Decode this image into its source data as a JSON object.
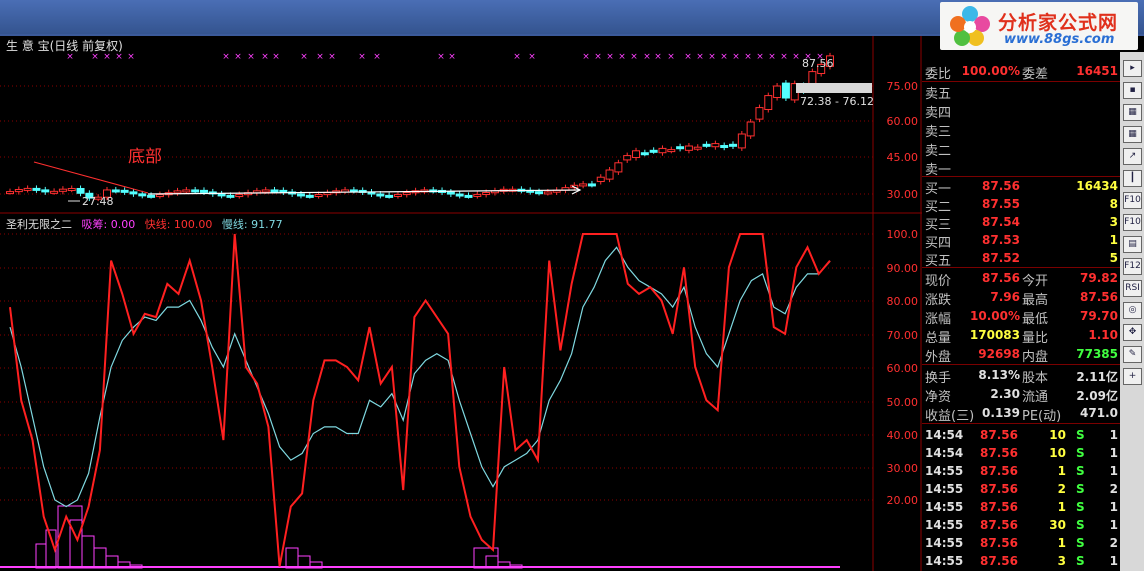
{
  "header": {
    "title": "生 意 宝(日线 前复权)",
    "logo_text": "分析家公式网",
    "logo_url": "www.88gs.com"
  },
  "main_chart": {
    "annotation": "底部",
    "low_label": "27.48",
    "high_label": "87.56",
    "range_label": "72.38 - 76.12",
    "y_ticks": [
      "75.00",
      "60.00",
      "45.00",
      "30.00"
    ]
  },
  "indicator": {
    "name": "圣利无限之二",
    "xichou_label": "吸筹: 0.00",
    "fast_label": "快线: 100.00",
    "slow_label": "慢线: 91.77",
    "y_ticks": [
      "100.0",
      "90.00",
      "80.00",
      "70.00",
      "60.00",
      "50.00",
      "40.00",
      "30.00",
      "20.00"
    ]
  },
  "quote": {
    "weibi": {
      "label": "委比",
      "value": "100.00%",
      "label2": "委差",
      "value2": "16451"
    },
    "sell": [
      {
        "label": "卖五",
        "price": "",
        "vol": ""
      },
      {
        "label": "卖四",
        "price": "",
        "vol": ""
      },
      {
        "label": "卖三",
        "price": "",
        "vol": ""
      },
      {
        "label": "卖二",
        "price": "",
        "vol": ""
      },
      {
        "label": "卖一",
        "price": "",
        "vol": ""
      }
    ],
    "buy": [
      {
        "label": "买一",
        "price": "87.56",
        "vol": "16434"
      },
      {
        "label": "买二",
        "price": "87.55",
        "vol": "8"
      },
      {
        "label": "买三",
        "price": "87.54",
        "vol": "3"
      },
      {
        "label": "买四",
        "price": "87.53",
        "vol": "1"
      },
      {
        "label": "买五",
        "price": "87.52",
        "vol": "5"
      }
    ],
    "stats": [
      {
        "l1": "现价",
        "v1": "87.56",
        "l2": "今开",
        "v2": "79.82"
      },
      {
        "l1": "涨跌",
        "v1": "7.96",
        "l2": "最高",
        "v2": "87.56"
      },
      {
        "l1": "涨幅",
        "v1": "10.00%",
        "l2": "最低",
        "v2": "79.70"
      },
      {
        "l1": "总量",
        "v1": "170083",
        "l2": "量比",
        "v2": "1.10"
      },
      {
        "l1": "外盘",
        "v1": "92698",
        "l2": "内盘",
        "v2": "77385"
      }
    ],
    "stats2": [
      {
        "l1": "换手",
        "v1": "8.13%",
        "l2": "股本",
        "v2": "2.11亿"
      },
      {
        "l1": "净资",
        "v1": "2.30",
        "l2": "流通",
        "v2": "2.09亿"
      },
      {
        "l1": "收益(三)",
        "v1": "0.139",
        "l2": "PE(动)",
        "v2": "471.0"
      }
    ],
    "ticks": [
      {
        "time": "14:54",
        "price": "87.56",
        "vol": "10",
        "side": "S",
        "n": "1"
      },
      {
        "time": "14:54",
        "price": "87.56",
        "vol": "10",
        "side": "S",
        "n": "1"
      },
      {
        "time": "14:55",
        "price": "87.56",
        "vol": "1",
        "side": "S",
        "n": "1"
      },
      {
        "time": "14:55",
        "price": "87.56",
        "vol": "2",
        "side": "S",
        "n": "2"
      },
      {
        "time": "14:55",
        "price": "87.56",
        "vol": "1",
        "side": "S",
        "n": "1"
      },
      {
        "time": "14:55",
        "price": "87.56",
        "vol": "30",
        "side": "S",
        "n": "1"
      },
      {
        "time": "14:55",
        "price": "87.56",
        "vol": "1",
        "side": "S",
        "n": "2"
      },
      {
        "time": "14:55",
        "price": "87.56",
        "vol": "3",
        "side": "S",
        "n": "1"
      }
    ]
  },
  "colors": {
    "up": "#ff3030",
    "down": "#54ffff",
    "grid": "#8b0000",
    "yellow": "#ffff40",
    "green": "#40ff40",
    "magenta": "#ff40ff",
    "slow": "#7fd8e0"
  },
  "toolbar": {
    "icons": [
      "arrow-icon",
      "k-icon",
      "table-icon",
      "grid-icon",
      "trend-icon",
      "candle-icon",
      "f10-icon",
      "f10b-icon",
      "chart-icon",
      "f12-icon",
      "rsi-icon",
      "target-icon",
      "move-icon",
      "pencil-icon",
      "plus-icon"
    ],
    "rsi_label": "RSI",
    "f10_label": "F10",
    "f12_label": "F12"
  }
}
